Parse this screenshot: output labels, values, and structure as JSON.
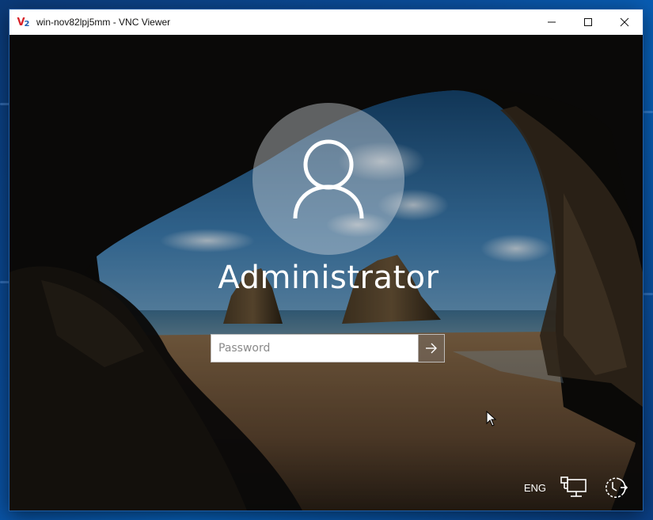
{
  "window": {
    "title": "win-nov82lpj5mm - VNC Viewer",
    "icon_name": "vnc-viewer-icon",
    "controls": {
      "minimize": "minimize-icon",
      "maximize": "maximize-icon",
      "close": "close-icon"
    }
  },
  "lock_screen": {
    "username": "Administrator",
    "avatar_icon": "user-icon",
    "password": {
      "placeholder": "Password",
      "value": ""
    },
    "submit_icon": "arrow-right-icon",
    "tray": {
      "language": "ENG",
      "network_icon": "network-icon",
      "power_icon": "ease-of-access-icon"
    }
  },
  "colors": {
    "desktop_blue": "#0a4f9e",
    "titlebar": "#ffffff",
    "vnc_red": "#d8232a",
    "vnc_blue": "#2060b0"
  }
}
